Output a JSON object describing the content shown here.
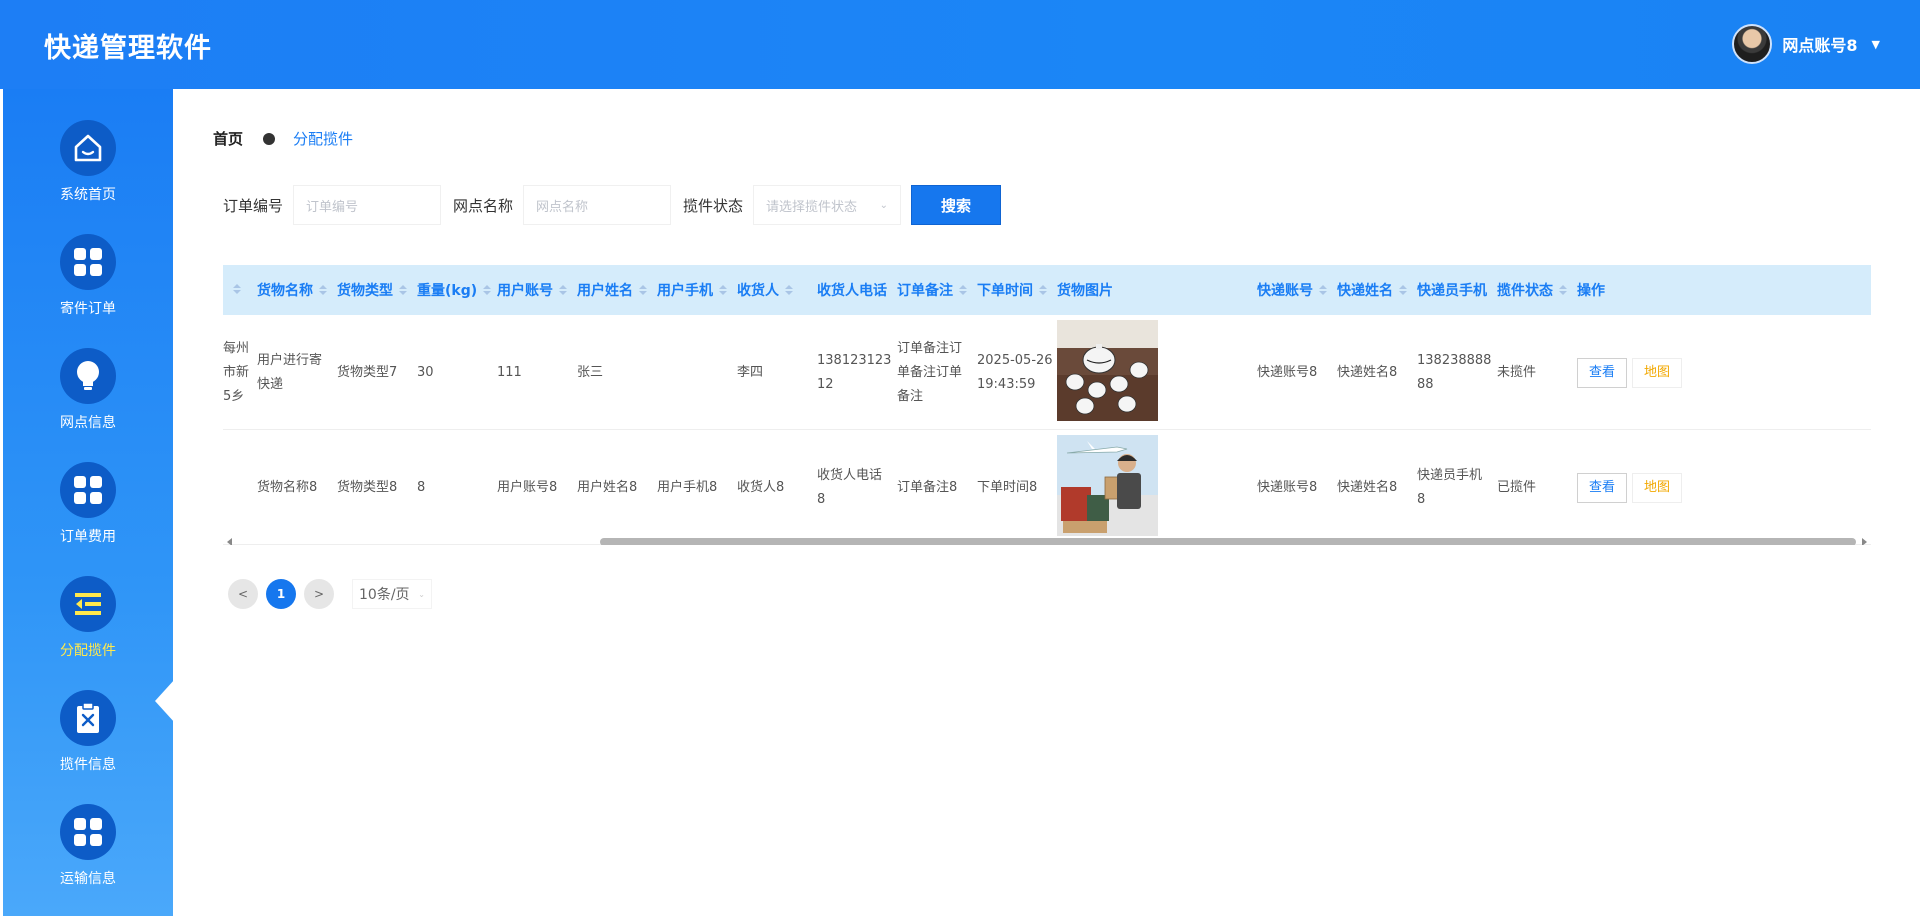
{
  "header": {
    "title": "快递管理软件",
    "username": "网点账号8",
    "caret": "▼"
  },
  "sidebar": {
    "items": [
      {
        "label": "系统首页",
        "icon": "home-icon"
      },
      {
        "label": "寄件订单",
        "icon": "grid-icon"
      },
      {
        "label": "网点信息",
        "icon": "lightbulb-icon"
      },
      {
        "label": "订单费用",
        "icon": "grid-icon"
      },
      {
        "label": "分配揽件",
        "icon": "list-indent-icon",
        "active": true
      },
      {
        "label": "揽件信息",
        "icon": "clipboard-x-icon"
      },
      {
        "label": "运输信息",
        "icon": "grid-icon"
      }
    ]
  },
  "breadcrumb": {
    "home": "首页",
    "current": "分配揽件"
  },
  "search": {
    "order_no_label": "订单编号",
    "order_no_placeholder": "订单编号",
    "outlet_label": "网点名称",
    "outlet_placeholder": "网点名称",
    "status_label": "揽件状态",
    "status_placeholder": "请选择揽件状态",
    "button": "搜索"
  },
  "table": {
    "headers": [
      "货物名称",
      "货物类型",
      "重量(kg)",
      "用户账号",
      "用户姓名",
      "用户手机",
      "收货人",
      "收货人电话",
      "订单备注",
      "下单时间",
      "货物图片",
      "快递账号",
      "快递姓名",
      "快递员手机",
      "揽件状态",
      "操作"
    ],
    "rows": [
      {
        "clipped": [
          "每州",
          "市新",
          "5乡"
        ],
        "goods_name": [
          "用户进行寄",
          "快递"
        ],
        "goods_type": "货物类型7",
        "weight": "30",
        "user_account": "111",
        "user_name": "张三",
        "user_phone": "",
        "receiver": "李四",
        "receiver_phone": [
          "138123123",
          "12"
        ],
        "remark": [
          "订单备注订",
          "单备注订单",
          "备注"
        ],
        "order_time": [
          "2025-05-26",
          "19:43:59"
        ],
        "image": "tea-set",
        "courier_account": "快递账号8",
        "courier_name": "快递姓名8",
        "courier_phone": [
          "138238888",
          "88"
        ],
        "status": "未揽件",
        "view": "查看",
        "map": "地图"
      },
      {
        "clipped": [
          ""
        ],
        "goods_name": [
          "货物名称8"
        ],
        "goods_type": "货物类型8",
        "weight": "8",
        "user_account": "用户账号8",
        "user_name": "用户姓名8",
        "user_phone": "用户手机8",
        "receiver": "收货人8",
        "receiver_phone": [
          "收货人电话",
          "8"
        ],
        "remark": [
          "订单备注8"
        ],
        "order_time": [
          "下单时间8"
        ],
        "image": "courier-delivery",
        "courier_account": "快递账号8",
        "courier_name": "快递姓名8",
        "courier_phone": [
          "快递员手机",
          "8"
        ],
        "status": "已揽件",
        "view": "查看",
        "map": "地图"
      }
    ]
  },
  "pagination": {
    "prev": "<",
    "current": "1",
    "next": ">",
    "page_size": "10条/页"
  }
}
